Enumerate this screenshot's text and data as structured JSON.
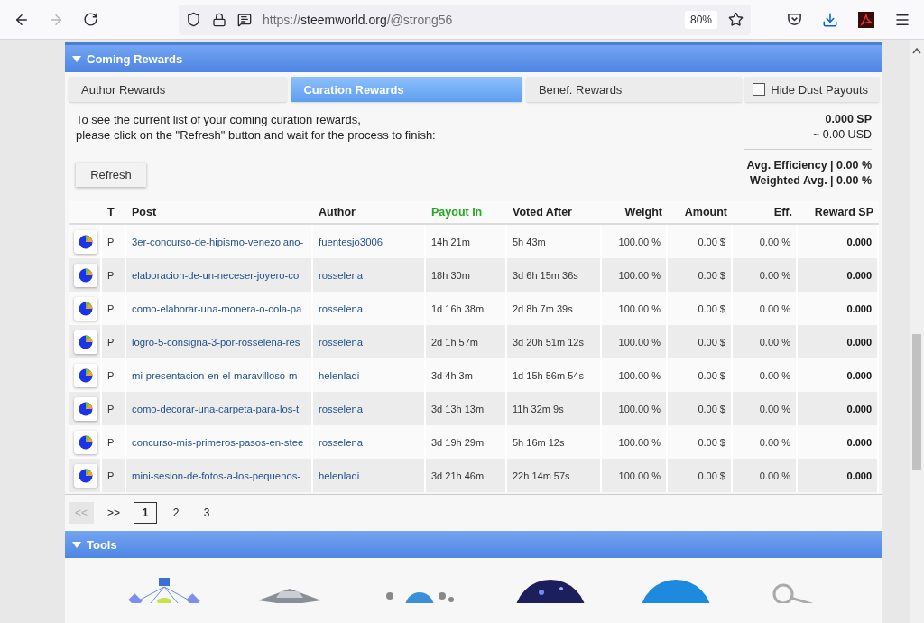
{
  "browser": {
    "url_scheme": "https://",
    "url_host": "steemworld.org",
    "url_path": "/@strong56",
    "zoom": "80%",
    "forward_disabled": true
  },
  "rewards_section": {
    "title": "Coming Rewards",
    "expanded": true
  },
  "tabs": [
    {
      "label": "Author Rewards",
      "selected": false
    },
    {
      "label": "Curation Rewards",
      "selected": true
    },
    {
      "label": "Benef. Rewards",
      "selected": false
    }
  ],
  "hide_dust": {
    "label": "Hide Dust Payouts",
    "checked": false
  },
  "info": {
    "lines": [
      "To see the current list of your coming curation rewards,",
      "please click on the \"Refresh\" button and wait for the process to finish:"
    ],
    "sp": "0.000 SP",
    "usd": "~ 0.00 USD",
    "avg_efficiency": "Avg. Efficiency | 0.00 %",
    "weighted_avg": "Weighted Avg. | 0.00 %"
  },
  "refresh_button": "Refresh",
  "table": {
    "columns": [
      {
        "label": "T",
        "sorted": false
      },
      {
        "label": "Post",
        "sorted": false
      },
      {
        "label": "Author",
        "sorted": false
      },
      {
        "label": "Payout In",
        "sorted": true
      },
      {
        "label": "Voted After",
        "sorted": false
      },
      {
        "label": "Weight",
        "sorted": false
      },
      {
        "label": "Amount",
        "sorted": false
      },
      {
        "label": "Eff.",
        "sorted": false
      },
      {
        "label": "Reward SP",
        "sorted": false
      }
    ],
    "rows": [
      {
        "type": "P",
        "post": "3er-concurso-de-hipismo-venezolano-",
        "author": "fuentesjo3006",
        "payout_in": "14h 21m",
        "voted_after": "5h 43m",
        "weight": "100.00 %",
        "amount": "0.00 $",
        "eff": "0.00 %",
        "reward": "0.000"
      },
      {
        "type": "P",
        "post": "elaboracion-de-un-neceser-joyero-co",
        "author": "rosselena",
        "payout_in": "18h 30m",
        "voted_after": "3d 6h 15m 36s",
        "weight": "100.00 %",
        "amount": "0.00 $",
        "eff": "0.00 %",
        "reward": "0.000"
      },
      {
        "type": "P",
        "post": "como-elaborar-una-monera-o-cola-pa",
        "author": "rosselena",
        "payout_in": "1d 16h 38m",
        "voted_after": "2d 8h 7m 39s",
        "weight": "100.00 %",
        "amount": "0.00 $",
        "eff": "0.00 %",
        "reward": "0.000"
      },
      {
        "type": "P",
        "post": "logro-5-consigna-3-por-rosselena-res",
        "author": "rosselena",
        "payout_in": "2d 1h 57m",
        "voted_after": "3d 20h 51m 12s",
        "weight": "100.00 %",
        "amount": "0.00 $",
        "eff": "0.00 %",
        "reward": "0.000"
      },
      {
        "type": "P",
        "post": "mi-presentacion-en-el-maravilloso-m",
        "author": "helenladi",
        "payout_in": "3d 4h 3m",
        "voted_after": "1d 15h 56m 54s",
        "weight": "100.00 %",
        "amount": "0.00 $",
        "eff": "0.00 %",
        "reward": "0.000"
      },
      {
        "type": "P",
        "post": "como-decorar-una-carpeta-para-los-t",
        "author": "rosselena",
        "payout_in": "3d 13h 13m",
        "voted_after": "11h 32m 9s",
        "weight": "100.00 %",
        "amount": "0.00 $",
        "eff": "0.00 %",
        "reward": "0.000"
      },
      {
        "type": "P",
        "post": "concurso-mis-primeros-pasos-en-stee",
        "author": "rosselena",
        "payout_in": "3d 19h 29m",
        "voted_after": "5h 16m 12s",
        "weight": "100.00 %",
        "amount": "0.00 $",
        "eff": "0.00 %",
        "reward": "0.000"
      },
      {
        "type": "P",
        "post": "mini-sesion-de-fotos-a-los-pequenos-",
        "author": "helenladi",
        "payout_in": "3d 21h 46m",
        "voted_after": "22h 14m 57s",
        "weight": "100.00 %",
        "amount": "0.00 $",
        "eff": "0.00 %",
        "reward": "0.000"
      }
    ]
  },
  "pagination": {
    "prev": {
      "label": "<<",
      "disabled": true
    },
    "next": {
      "label": ">>",
      "disabled": false
    },
    "pages": [
      {
        "label": "1",
        "selected": true
      },
      {
        "label": "2",
        "selected": false
      },
      {
        "label": "3",
        "selected": false
      }
    ]
  },
  "tools_section": {
    "title": "Tools",
    "expanded": true
  }
}
